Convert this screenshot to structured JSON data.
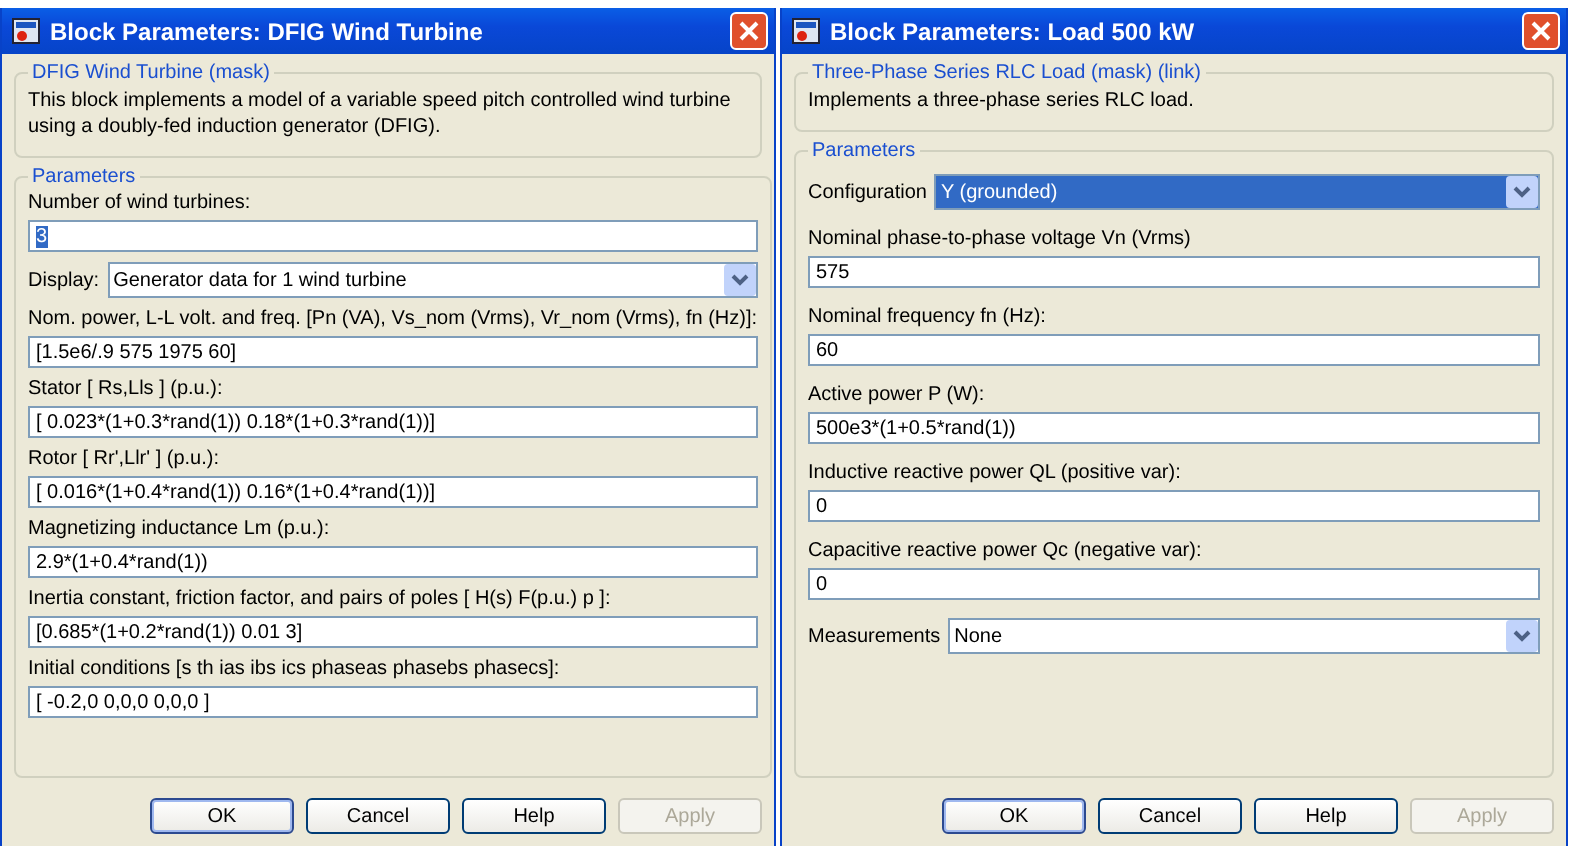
{
  "dialogs": [
    {
      "title": "Block Parameters: DFIG Wind Turbine",
      "mask": {
        "legend": "DFIG Wind Turbine (mask)",
        "description": "This block implements a  model of a variable speed pitch controlled wind turbine using a doubly-fed induction generator (DFIG)."
      },
      "parameters": {
        "legend": "Parameters",
        "items": [
          {
            "kind": "field",
            "label": "Number of wind turbines:",
            "value": "3",
            "highlighted": true
          },
          {
            "kind": "dropdown",
            "label": "Display:",
            "value": "Generator data for 1 wind turbine",
            "highlighted": false
          },
          {
            "kind": "field",
            "label": "Nom. power, L-L volt. and freq. [Pn (VA), Vs_nom (Vrms), Vr_nom (Vrms), fn (Hz)]:",
            "value": "[1.5e6/.9 575 1975 60]",
            "highlighted": false
          },
          {
            "kind": "field",
            "label": "Stator [ Rs,Lls ] (p.u.):",
            "value": "[ 0.023*(1+0.3*rand(1)) 0.18*(1+0.3*rand(1))]",
            "highlighted": false
          },
          {
            "kind": "field",
            "label": "Rotor [ Rr',Llr' ] (p.u.):",
            "value": "[ 0.016*(1+0.4*rand(1)) 0.16*(1+0.4*rand(1))]",
            "highlighted": false
          },
          {
            "kind": "field",
            "label": "Magnetizing inductance Lm (p.u.):",
            "value": "2.9*(1+0.4*rand(1))",
            "highlighted": false
          },
          {
            "kind": "field",
            "label": "Inertia constant, friction factor, and pairs of poles [ H(s)  F(p.u.)  p ]:",
            "value": "[0.685*(1+0.2*rand(1)) 0.01 3]",
            "highlighted": false
          },
          {
            "kind": "field",
            "label": "Initial conditions [s  th  ias  ibs  ics  phaseas phasebs phasecs]:",
            "value": "[ -0.2,0   0,0,0   0,0,0 ]",
            "highlighted": false
          }
        ]
      },
      "buttons": [
        {
          "label": "OK",
          "default": true,
          "disabled": false
        },
        {
          "label": "Cancel",
          "default": false,
          "disabled": false
        },
        {
          "label": "Help",
          "default": false,
          "disabled": false
        },
        {
          "label": "Apply",
          "default": false,
          "disabled": true
        }
      ]
    },
    {
      "title": "Block Parameters: Load 500 kW",
      "mask": {
        "legend": "Three-Phase Series RLC Load (mask) (link)",
        "description": "Implements a three-phase series RLC load."
      },
      "parameters": {
        "legend": "Parameters",
        "items": [
          {
            "kind": "dropdown",
            "label": "Configuration",
            "value": "Y (grounded)",
            "highlighted": true
          },
          {
            "kind": "field",
            "label": "Nominal phase-to-phase voltage Vn (Vrms)",
            "value": "575",
            "highlighted": false
          },
          {
            "kind": "field",
            "label": "Nominal frequency fn (Hz):",
            "value": "60",
            "highlighted": false
          },
          {
            "kind": "field",
            "label": "Active power P (W):",
            "value": "500e3*(1+0.5*rand(1))",
            "highlighted": false
          },
          {
            "kind": "field",
            "label": "Inductive reactive power QL (positive var):",
            "value": "0",
            "highlighted": false
          },
          {
            "kind": "field",
            "label": "Capacitive reactive power Qc (negative var):",
            "value": "0",
            "highlighted": false
          },
          {
            "kind": "dropdown",
            "label": "Measurements",
            "value": "None",
            "highlighted": false
          }
        ]
      },
      "buttons": [
        {
          "label": "OK",
          "default": true,
          "disabled": false
        },
        {
          "label": "Cancel",
          "default": false,
          "disabled": false
        },
        {
          "label": "Help",
          "default": false,
          "disabled": false
        },
        {
          "label": "Apply",
          "default": false,
          "disabled": true
        }
      ]
    }
  ]
}
